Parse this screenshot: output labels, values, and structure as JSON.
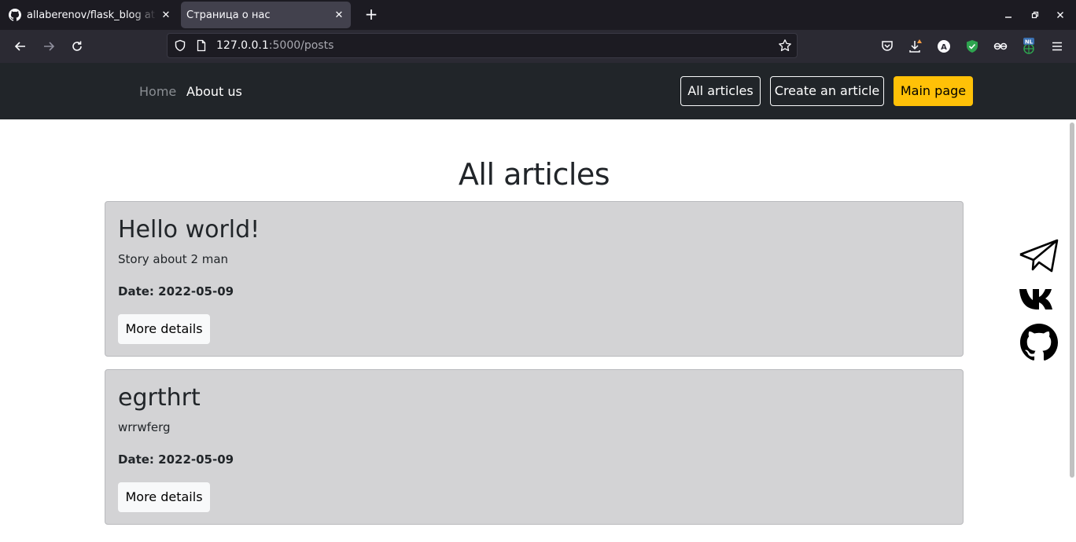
{
  "browser": {
    "tabs": [
      {
        "title": "allaberenov/flask_blog at",
        "icon": "github-icon",
        "active": false
      },
      {
        "title": "Страница о нас",
        "icon": null,
        "active": true
      }
    ],
    "url_host": "127.0.0.1",
    "url_path": ":5000/posts",
    "extension_badge": "NL"
  },
  "site": {
    "nav": {
      "home": "Home",
      "about": "About us"
    },
    "buttons": {
      "all_articles": "All articles",
      "create_article": "Create an article",
      "main_page": "Main page"
    },
    "page_title": "All articles",
    "articles": [
      {
        "title": "Hello world!",
        "intro": "Story about 2 man",
        "date": "Date: 2022-05-09",
        "button": "More details"
      },
      {
        "title": "egrthrt",
        "intro": "wrrwferg",
        "date": "Date: 2022-05-09",
        "button": "More details"
      }
    ],
    "social": [
      "telegram-icon",
      "vk-icon",
      "github-icon"
    ],
    "colors": {
      "header_bg": "#212529",
      "accent": "#ffc107",
      "card_bg": "#d3d3d5"
    }
  }
}
